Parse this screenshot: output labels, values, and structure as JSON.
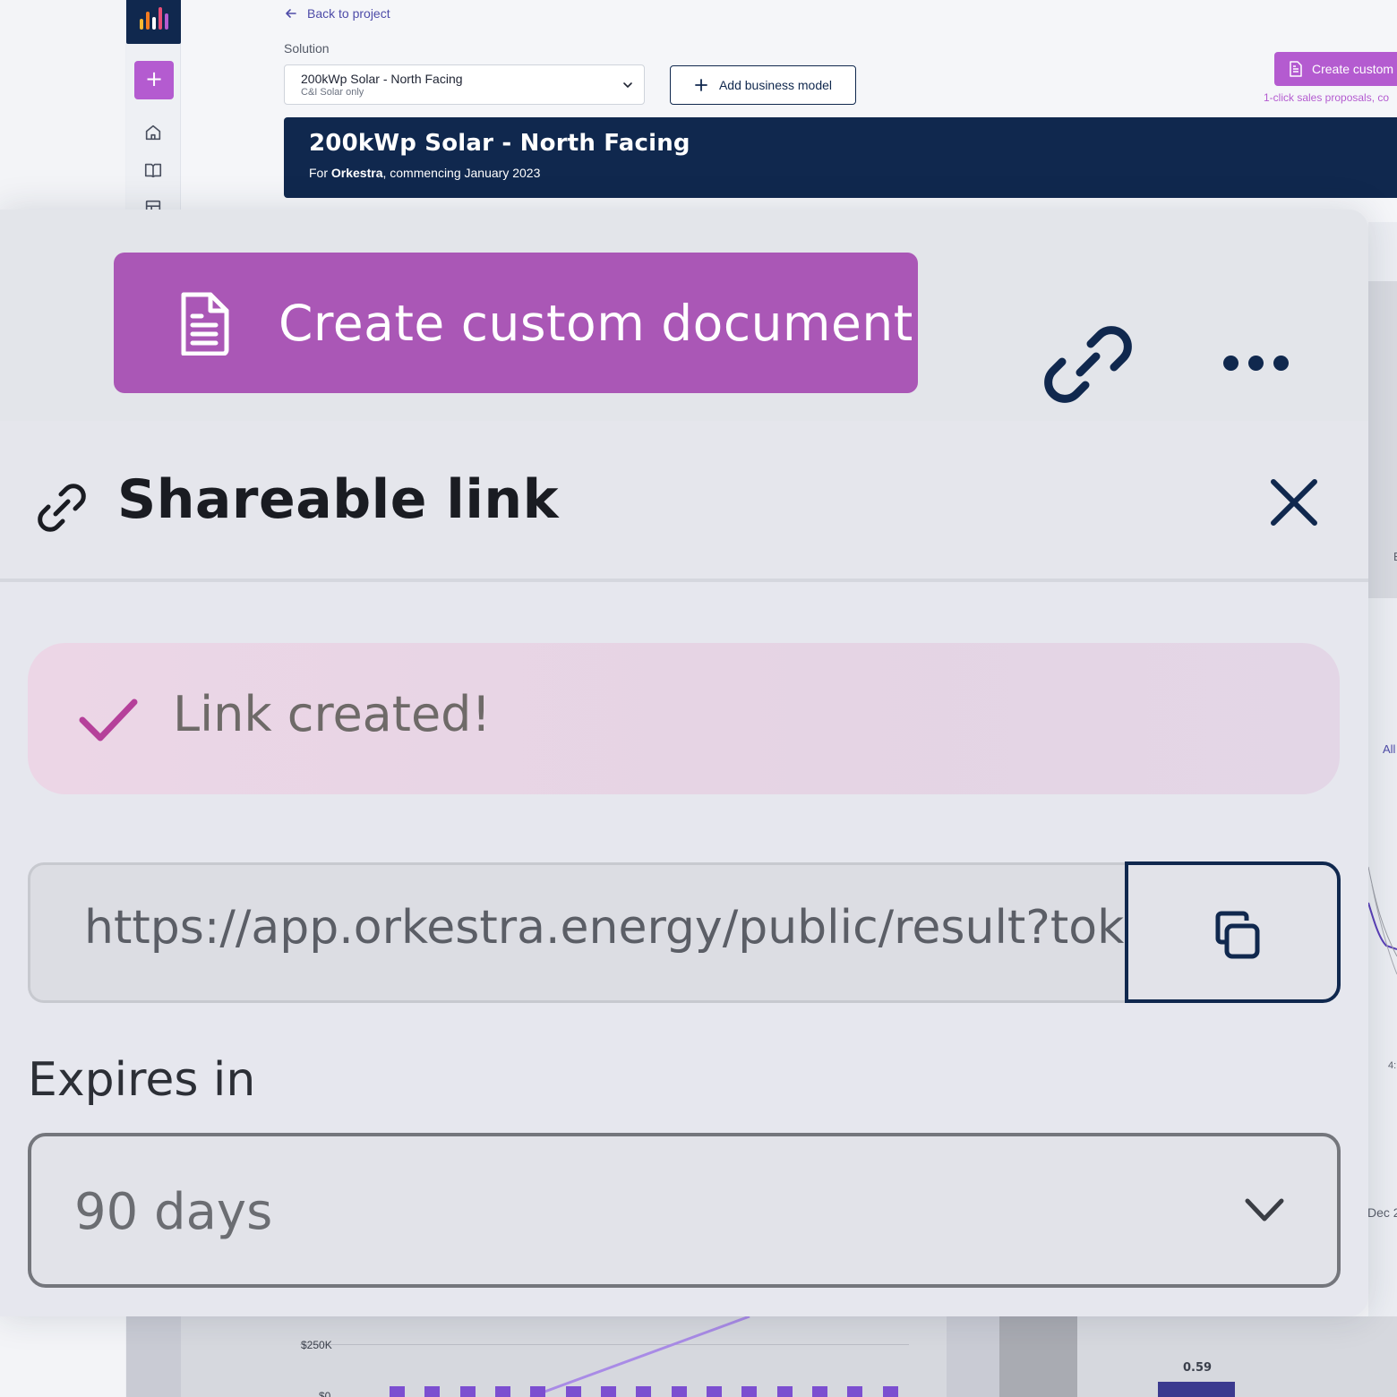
{
  "sidebar": {
    "logo_colors": [
      "#f7b733",
      "#f47c20",
      "#e94e77",
      "#b45bd0",
      "#ffffff"
    ],
    "new_button_label": "+",
    "icons": [
      "home-icon",
      "book-icon",
      "table-icon"
    ]
  },
  "header": {
    "back_link": "Back to project",
    "solution_label": "Solution",
    "solution_select": {
      "value": "200kWp Solar - North Facing",
      "subtitle": "C&I Solar only"
    },
    "add_model_button": "Add business model",
    "create_custom_button": "Create custom",
    "tagline": "1-click sales proposals, co"
  },
  "banner": {
    "title": "200kWp Solar - North Facing",
    "prefix": "For ",
    "client": "Orkestra",
    "suffix": ", commencing January 2023"
  },
  "right_strip": {
    "text_all": "All",
    "text_dec": "Dec 2",
    "text_tick": "4:",
    "text_e": "E"
  },
  "bottom_chart": {
    "y_axis_top": "$250K",
    "y_axis_zero": "$0",
    "value_label": "0.59"
  },
  "zoom": {
    "create_custom_document": "Create custom document",
    "dialog_title": "Shareable link",
    "success_message": "Link created!",
    "url": "https://app.orkestra.energy/public/result?tok",
    "expires_label": "Expires in",
    "expires_value": "90 days"
  },
  "colors": {
    "brand_navy": "#10284e",
    "brand_purple": "#b45bd0",
    "success_check": "#b5409a"
  }
}
